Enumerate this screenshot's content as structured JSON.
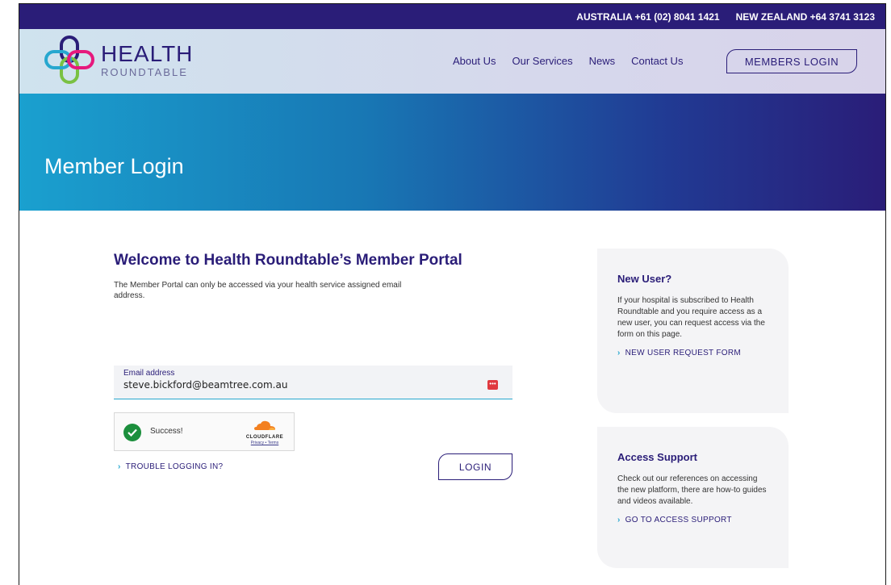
{
  "topbar": {
    "australia": "AUSTRALIA +61 (02) 8041 1421",
    "new_zealand": "NEW ZEALAND +64 3741 3123"
  },
  "header": {
    "logo_health": "HEALTH",
    "logo_roundtable": "ROUNDTABLE",
    "nav": [
      "About Us",
      "Our Services",
      "News",
      "Contact Us"
    ],
    "members_login": "MEMBERS LOGIN"
  },
  "hero": {
    "title": "Member Login"
  },
  "main": {
    "welcome_title": "Welcome to Health Roundtable’s Member Portal",
    "welcome_desc": "The Member Portal can only be accessed via your health service assigned email address.",
    "email_label": "Email address",
    "email_value": "steve.bickford@beamtree.com.au",
    "captcha_status": "Success!",
    "captcha_brand": "CLOUDFLARE",
    "captcha_links": "Privacy • Terms",
    "trouble_link": "TROUBLE LOGGING IN?",
    "login_button": "LOGIN"
  },
  "sidebar": {
    "new_user_title": "New User?",
    "new_user_text": "If your hospital is subscribed to Health Roundtable and you require access as a new user, you can request access via the form on this page.",
    "new_user_link": "NEW USER REQUEST FORM",
    "support_title": "Access Support",
    "support_text": "Check out our references on accessing the new platform, there are how-to guides and videos available.",
    "support_link": "GO TO ACCESS SUPPORT"
  },
  "colors": {
    "brand_purple": "#2a1d78",
    "accent_cyan": "#27a7cf",
    "success_green": "#1c8f3d",
    "cloudflare_orange": "#f38020"
  }
}
